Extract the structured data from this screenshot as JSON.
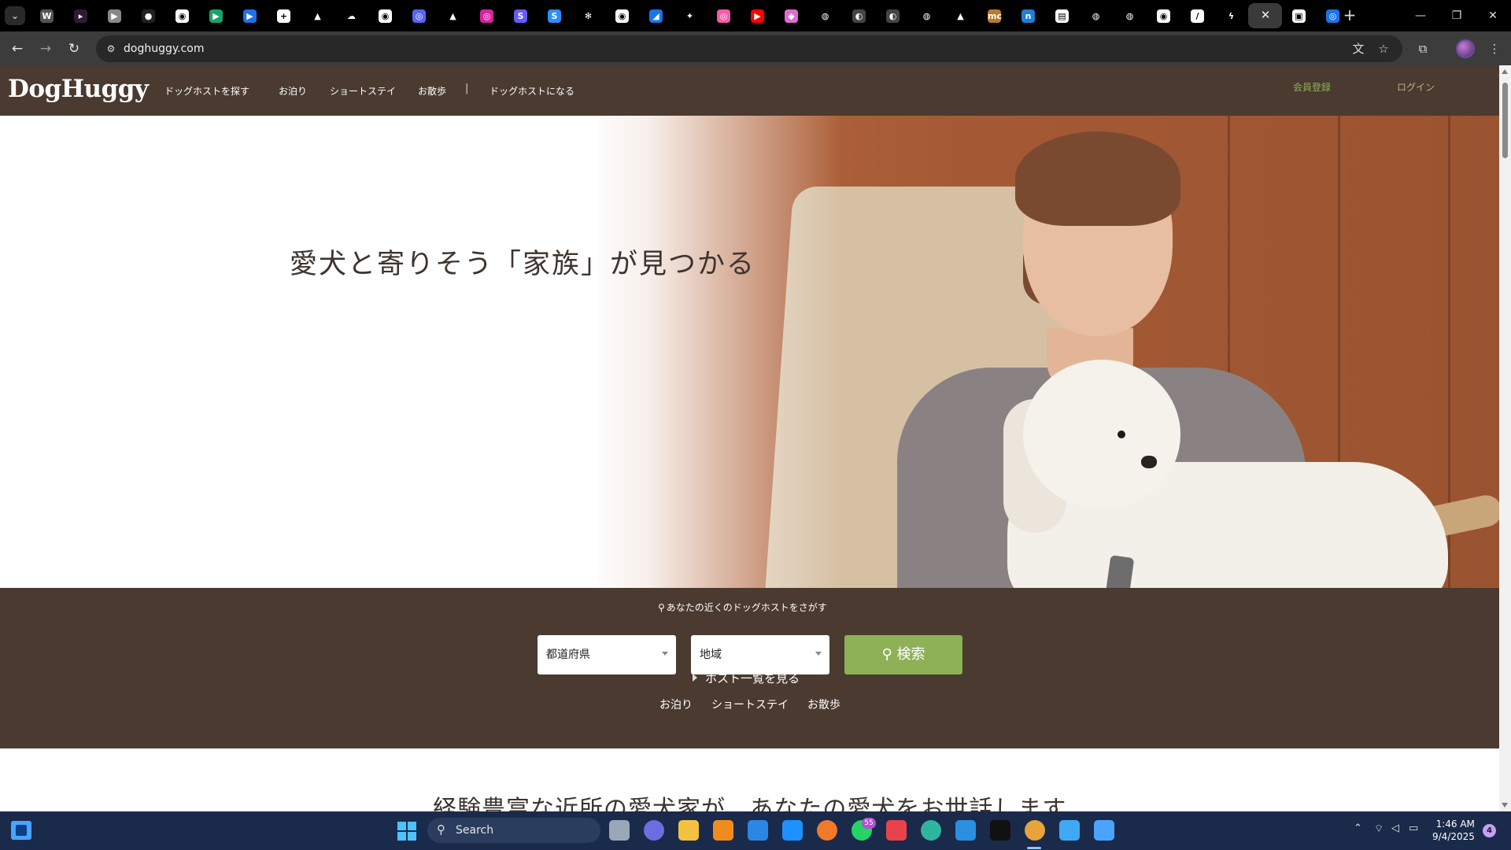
{
  "browser": {
    "tabs": [
      {
        "icon": "wordpress-icon",
        "glyph": "W",
        "color": "#555555"
      },
      {
        "icon": "youtube-play-icon",
        "glyph": "▸",
        "color": "#2c1d33"
      },
      {
        "icon": "media-play-icon",
        "glyph": "▶",
        "color": "#888888"
      },
      {
        "icon": "dark-circle-icon",
        "glyph": "●",
        "color": "#222222"
      },
      {
        "icon": "github-icon",
        "glyph": "◉",
        "color": "#ffffff"
      },
      {
        "icon": "google-play-icon",
        "glyph": "▶",
        "color": "#18a36d"
      },
      {
        "icon": "google-play-icon",
        "glyph": "▶",
        "color": "#1a73e8"
      },
      {
        "icon": "plus-square-icon",
        "glyph": "+",
        "color": "#ffffff"
      },
      {
        "icon": "triangle-icon",
        "glyph": "▲",
        "color": "#000000"
      },
      {
        "icon": "cloud-icon",
        "glyph": "☁",
        "color": "#000000"
      },
      {
        "icon": "github-icon",
        "glyph": "◉",
        "color": "#ffffff"
      },
      {
        "icon": "discord-icon",
        "glyph": "◎",
        "color": "#5865f2"
      },
      {
        "icon": "triangle-icon",
        "glyph": "▲",
        "color": "#000000"
      },
      {
        "icon": "instagram-icon",
        "glyph": "◎",
        "color": "#d6249f"
      },
      {
        "icon": "stripe-icon",
        "glyph": "S",
        "color": "#635bff"
      },
      {
        "icon": "slack-icon",
        "glyph": "S",
        "color": "#2d8cff"
      },
      {
        "icon": "openai-icon",
        "glyph": "✻",
        "color": "#000000"
      },
      {
        "icon": "github-icon",
        "glyph": "◉",
        "color": "#ffffff"
      },
      {
        "icon": "chart-icon",
        "glyph": "◢",
        "color": "#1a73e8"
      },
      {
        "icon": "sparkle-icon",
        "glyph": "✦",
        "color": "#000000"
      },
      {
        "icon": "color-wheel-icon",
        "glyph": "◎",
        "color": "#f25ca8"
      },
      {
        "icon": "youtube-icon",
        "glyph": "▶",
        "color": "#ff0000"
      },
      {
        "icon": "gradient-icon",
        "glyph": "◆",
        "color": "#e06ad0"
      },
      {
        "icon": "globe-icon",
        "glyph": "◍",
        "color": "#000000"
      },
      {
        "icon": "compass-icon",
        "glyph": "◐",
        "color": "#444444"
      },
      {
        "icon": "compass-icon",
        "glyph": "◐",
        "color": "#444444"
      },
      {
        "icon": "globe-icon",
        "glyph": "◍",
        "color": "#000000"
      },
      {
        "icon": "triangle-icon",
        "glyph": "▲",
        "color": "#000000"
      },
      {
        "icon": "mc-icon",
        "glyph": "mc",
        "color": "#b87a2e"
      },
      {
        "icon": "n-icon",
        "glyph": "n",
        "color": "#1f7ed6"
      },
      {
        "icon": "hotel-icon",
        "glyph": "▤",
        "color": "#ffffff"
      },
      {
        "icon": "globe-icon",
        "glyph": "◍",
        "color": "#000000"
      },
      {
        "icon": "globe-icon",
        "glyph": "◍",
        "color": "#000000"
      },
      {
        "icon": "github-icon",
        "glyph": "◉",
        "color": "#ffffff"
      },
      {
        "icon": "slash-icon",
        "glyph": "/",
        "color": "#ffffff"
      },
      {
        "icon": "zap-icon",
        "glyph": "ϟ",
        "color": "#000000"
      },
      {
        "icon": "close-icon",
        "glyph": "✕",
        "color": "#3a3a3a",
        "active": true
      },
      {
        "icon": "frame-icon",
        "glyph": "▣",
        "color": "#ffffff"
      },
      {
        "icon": "refresh-circle-icon",
        "glyph": "◎",
        "color": "#1a73e8"
      }
    ],
    "url": "doghuggy.com"
  },
  "site": {
    "logo": "DogHuggy",
    "nav": {
      "find_host": "ドッグホストを探す",
      "stay": "お泊り",
      "short_stay": "ショートステイ",
      "walk": "お散歩",
      "separator": "|",
      "become_host": "ドッグホストになる"
    },
    "header_right": {
      "register": "会員登録",
      "login": "ログイン",
      "register_color": "#8eb158",
      "login_color": "#c6a98a"
    },
    "hero": {
      "title": "愛犬と寄りそう「家族」が見つかる"
    },
    "search": {
      "caption": "あなたの近くのドッグホストをさがす",
      "prefecture": "都道府県",
      "region": "地域",
      "button": "検索",
      "host_list": "ホスト一覧を見る",
      "links": [
        "お泊り",
        "ショートステイ",
        "お散歩"
      ]
    },
    "section_title": "経験豊富な近所の愛犬家が、あなたの愛犬をお世話します",
    "colors": {
      "header_bg": "#4a3a30",
      "search_button": "#8eb158",
      "text_dark": "#3e342e"
    }
  },
  "taskbar": {
    "search_label": "Search",
    "whatsapp_badge": "55",
    "time": "1:46 AM",
    "date": "9/4/2025",
    "notifications": "4"
  }
}
